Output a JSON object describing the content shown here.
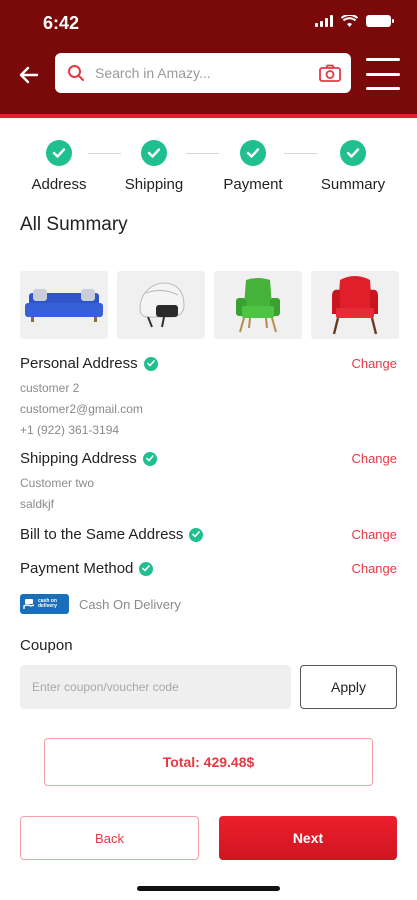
{
  "status_bar": {
    "time": "6:42"
  },
  "header": {
    "search_placeholder": "Search in Amazy...",
    "back_icon": "arrow-left-icon",
    "search_icon": "search-icon",
    "camera_icon": "camera-icon",
    "menu_icon": "hamburger-menu-icon"
  },
  "steps": [
    {
      "label": "Address",
      "done": true
    },
    {
      "label": "Shipping",
      "done": true
    },
    {
      "label": "Payment",
      "done": true
    },
    {
      "label": "Summary",
      "done": true
    }
  ],
  "summary": {
    "title": "All Summary",
    "products": [
      "blue sofa",
      "white helmet",
      "green armchair",
      "red armchair"
    ],
    "personal_address": {
      "title": "Personal Address",
      "change": "Change",
      "name": "customer 2",
      "email": "customer2@gmail.com",
      "phone": "+1 (922) 361-3194"
    },
    "shipping_address": {
      "title": "Shipping Address",
      "change": "Change",
      "name": "Customer two",
      "line": "saldkjf"
    },
    "billing": {
      "title": "Bill to the Same Address",
      "change": "Change"
    },
    "payment": {
      "title": "Payment Method",
      "change": "Change",
      "method": "Cash On Delivery",
      "logo_text_1": "cash on",
      "logo_text_2": "delivery"
    }
  },
  "coupon": {
    "title": "Coupon",
    "placeholder": "Enter coupon/voucher code",
    "apply_label": "Apply"
  },
  "total": {
    "label": "Total: 429.48$"
  },
  "footer": {
    "back_label": "Back",
    "next_label": "Next"
  },
  "colors": {
    "header_bg": "#7a0a0a",
    "accent": "#e53945",
    "success": "#1fbf8f"
  }
}
